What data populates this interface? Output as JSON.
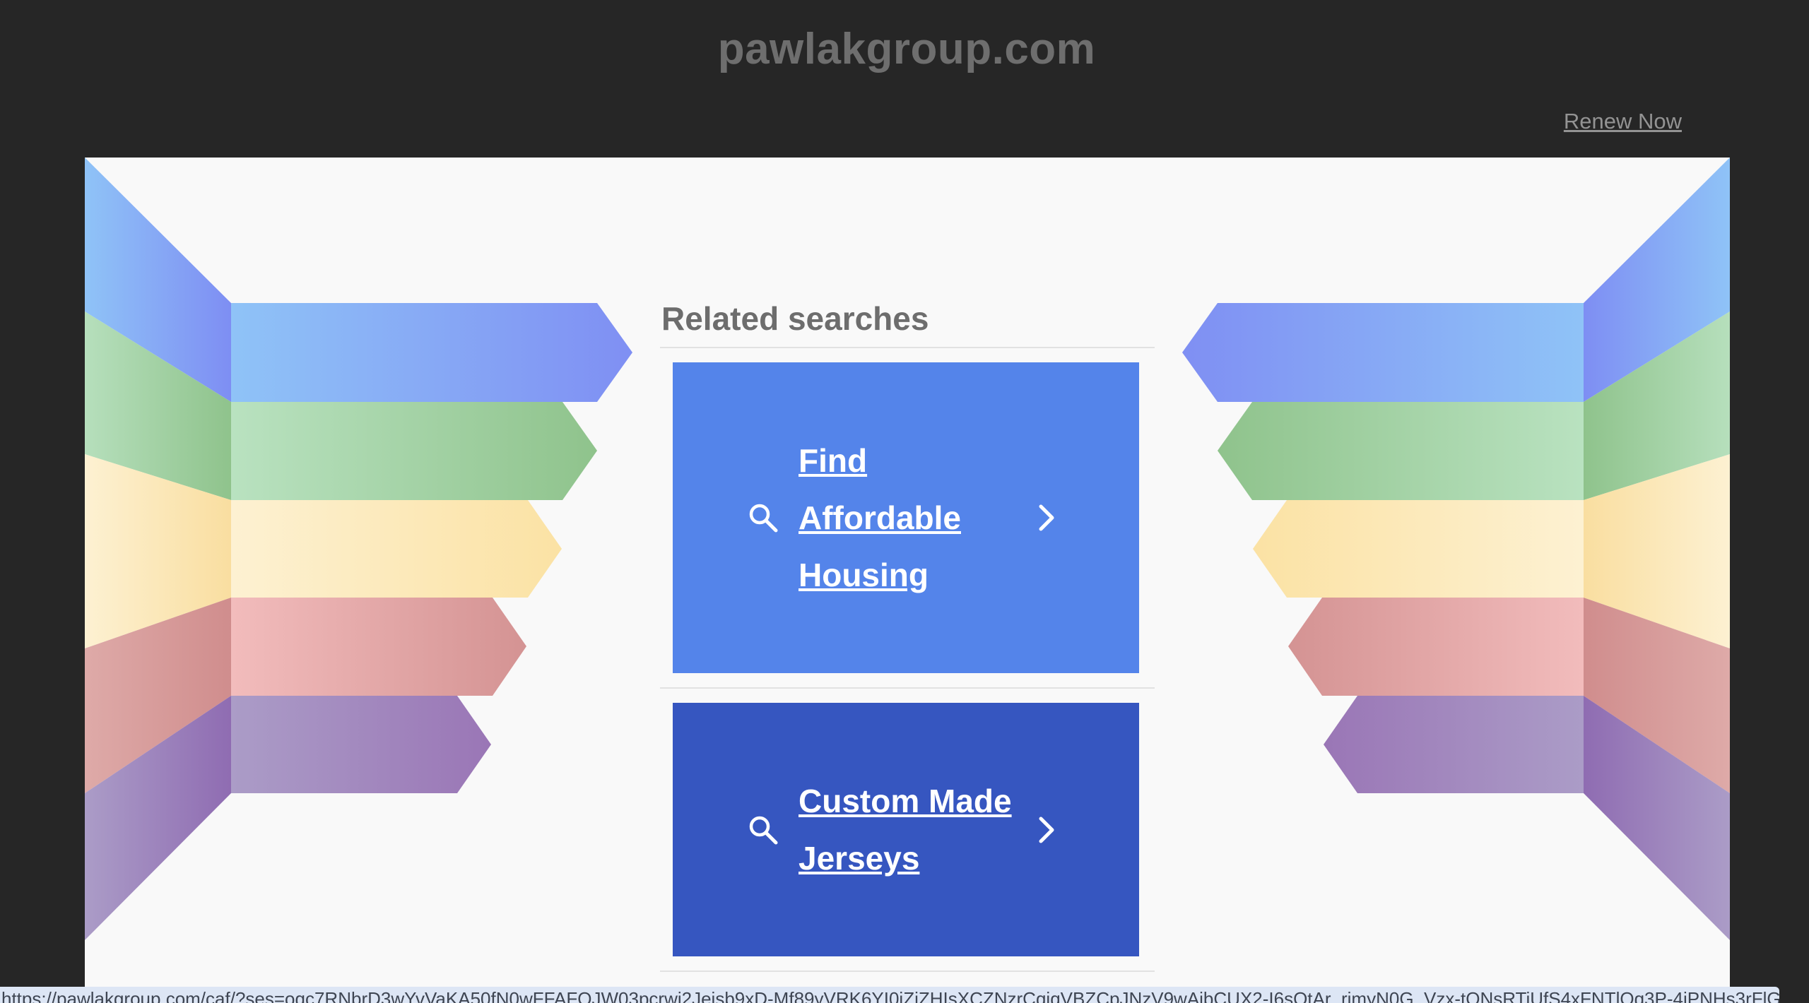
{
  "header": {
    "domain": "pawlakgroup.com",
    "renew_label": "Renew Now"
  },
  "related": {
    "title": "Related searches",
    "items": [
      {
        "label": "Find Affordable Housing",
        "icon": "search-icon",
        "arrow": "chevron-right-icon",
        "color": "#5484ea"
      },
      {
        "label": "Custom Made Jerseys",
        "icon": "search-icon",
        "arrow": "chevron-right-icon",
        "color": "#3656c0"
      }
    ]
  },
  "status_bar": {
    "url": "https://pawlakgroup.com/caf/?ses=oqc7RNbrD3wYvVaKA50fN0wFFAFQJW03pcrwi2Jeisb9xD-Mf89yVRK6YI0iZiZHIsXCZNzrCqiqVBZCpJNzV9wAibCUX2-I6sQtAr_rimyN0G_Vzx-tQNsRTiUfS4xFNTlQq3P-4iPNHs3rFlGtSWq"
  },
  "colors": {
    "page_background": "#262626",
    "content_background": "#f9f9f9",
    "domain_text": "#6e6e6e",
    "link_text": "#939393"
  }
}
